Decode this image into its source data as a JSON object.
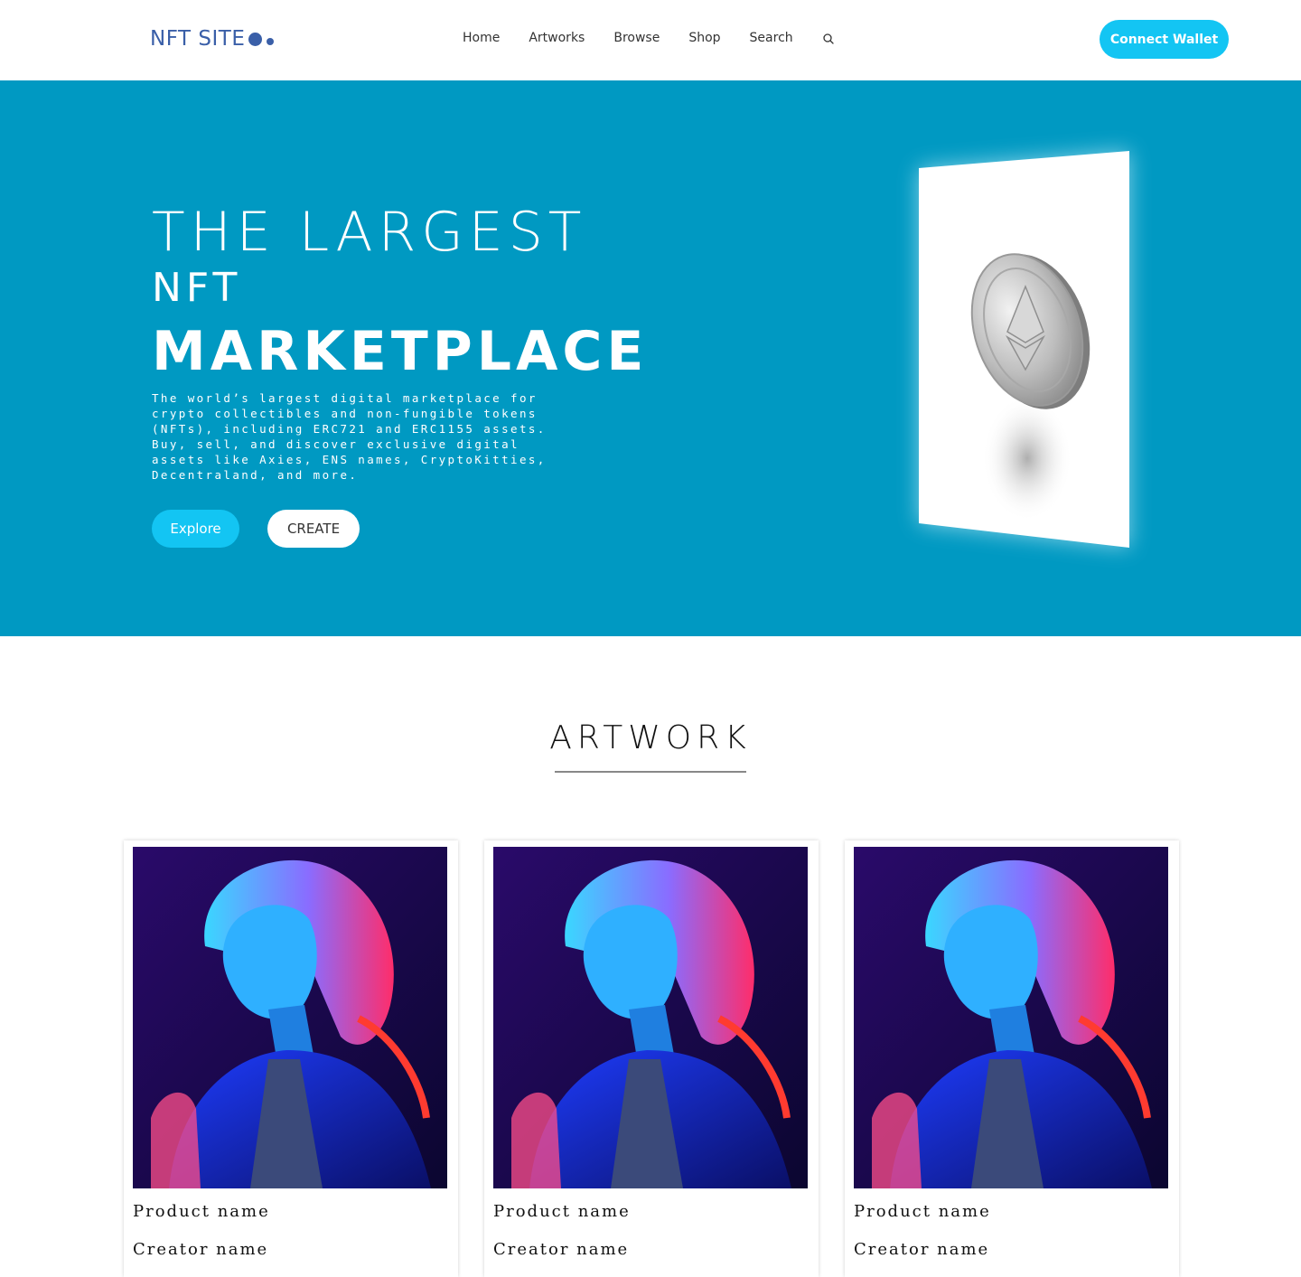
{
  "header": {
    "logo_text": "NFT SITE",
    "nav": [
      "Home",
      "Artworks",
      "Browse",
      "Shop",
      "Search"
    ],
    "search_icon": "search-icon",
    "connect_label": "Connect Wallet"
  },
  "hero": {
    "line1": "THE LARGEST",
    "line2": "NFT",
    "line3": "MARKETPLACE",
    "description": "The world’s largest digital marketplace for crypto collectibles and non-fungible tokens (NFTs), including ERC721 and ERC1155 assets. Buy, sell, and discover exclusive digital assets like Axies, ENS names, CryptoKitties, Decentraland, and more.",
    "explore_label": "Explore",
    "create_label": "CREATE",
    "image": "ethereum-coin-image"
  },
  "artwork": {
    "title": "ARTWORK",
    "cards": [
      {
        "product": "Product name",
        "creator": "Creator name",
        "image": "neon-portrait-image"
      },
      {
        "product": "Product name",
        "creator": "Creator name",
        "image": "neon-portrait-image"
      },
      {
        "product": "Product name",
        "creator": "Creator name",
        "image": "neon-portrait-image"
      }
    ]
  },
  "colors": {
    "hero_bg": "#0099c2",
    "accent": "#13c5f3",
    "logo": "#3a5fa8"
  }
}
